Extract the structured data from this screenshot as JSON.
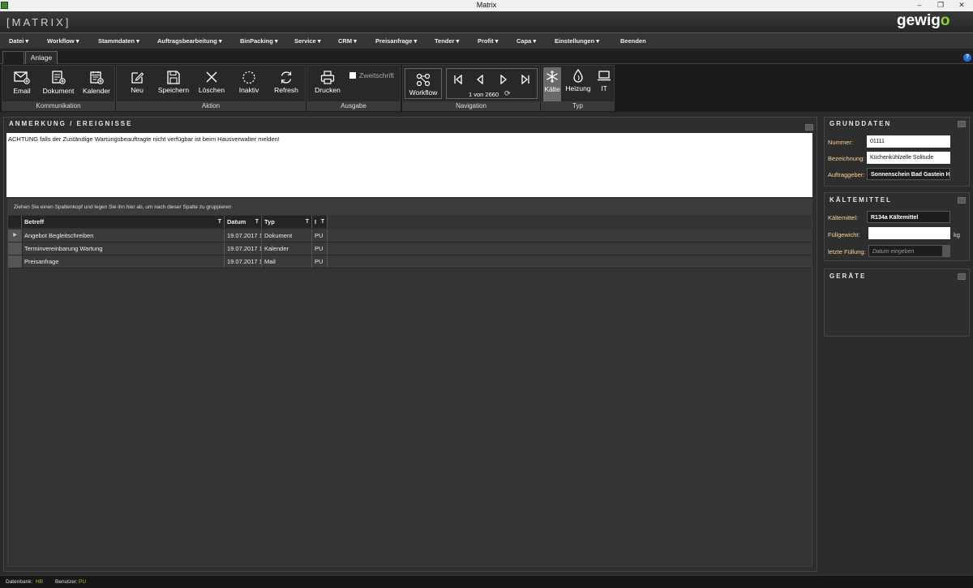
{
  "window": {
    "title": "Matrix",
    "min": "–",
    "max": "❐",
    "close": "✕"
  },
  "header": {
    "logo_left": "[MATRIX]",
    "logo_right_1": "gewig",
    "logo_right_2": "o"
  },
  "menu": [
    {
      "label": "Datei ▾"
    },
    {
      "label": "Workflow ▾"
    },
    {
      "label": "Stammdaten ▾"
    },
    {
      "label": "Auftragsbearbeitung ▾"
    },
    {
      "label": "BinPacking ▾"
    },
    {
      "label": "Service ▾"
    },
    {
      "label": "CRM ▾"
    },
    {
      "label": "Preisanfrage ▾"
    },
    {
      "label": "Tender ▾"
    },
    {
      "label": "Profit ▾"
    },
    {
      "label": "Capa ▾"
    },
    {
      "label": "Einstellungen ▾"
    },
    {
      "label": "Beenden"
    }
  ],
  "tabs": {
    "active": "Anlage",
    "help": "?"
  },
  "ribbon": {
    "kommunikation": {
      "label": "Kommunikation",
      "email": "Email",
      "dokument": "Dokument",
      "kalender": "Kalender"
    },
    "aktion": {
      "label": "Aktion",
      "neu": "Neu",
      "speichern": "Speichern",
      "loeschen": "Löschen",
      "inaktiv": "Inaktiv",
      "refresh": "Refresh"
    },
    "ausgabe": {
      "label": "Ausgabe",
      "drucken": "Drucken",
      "zweitschrift": "Zweitschrift"
    },
    "navigation": {
      "label": "Navigation",
      "workflow": "Workflow",
      "record": "1 von 2660"
    },
    "typ": {
      "label": "Typ",
      "kaelte": "Kälte",
      "heizung": "Heizung",
      "it": "IT"
    }
  },
  "notes": {
    "title": "ANMERKUNG / EREIGNISSE",
    "text": "ACHTUNG falls der Zuständige Wartungsbeauftragte nicht verfügbar ist beim Hausverwalter melden!"
  },
  "grid": {
    "group_hint": "Ziehen Sie einen Spaltenkopf und legen Sie ihn hier ab, um nach dieser Spalte zu gruppieren",
    "filter_icon": "T",
    "columns": [
      "Betreff",
      "Datum",
      "Typ",
      "I"
    ],
    "rows": [
      {
        "marker": "▶",
        "betreff": "Angebot Begleitschreiben",
        "datum": "19.07.2017 1",
        "typ": "Dokument",
        "i": "PU"
      },
      {
        "marker": "",
        "betreff": "Terminvereinbarung Wartung",
        "datum": "19.07.2017 1",
        "typ": "Kalender",
        "i": "PU"
      },
      {
        "marker": "",
        "betreff": "Preisanfrage",
        "datum": "19.07.2017 1",
        "typ": "Mail",
        "i": "PU"
      }
    ]
  },
  "grunddaten": {
    "title": "GRUNDDATEN",
    "nummer_label": "Nummer:",
    "nummer_value": "01111",
    "bezeichnung_label": "Bezeichnung:",
    "bezeichnung_value": "Küchenkühlzelle Solitude",
    "auftraggeber_label": "Auftraggeber:",
    "auftraggeber_value": "Sonnenschein Bad Gastein H"
  },
  "kaeltemittel": {
    "title": "KÄLTEMITTEL",
    "kaeltemittel_label": "Kältemittel:",
    "kaeltemittel_value": "R134a Kältemittel",
    "fuellgewicht_label": "Füllgewicht:",
    "fuellgewicht_value": "",
    "unit": "kg",
    "letzte_label": "letzte Füllung:",
    "letzte_placeholder": "Datum eingeben"
  },
  "geraete": {
    "title": "GERÄTE"
  },
  "status": {
    "db_label": "Datenbank:",
    "db_value": "HB",
    "user_label": "Benutzer:",
    "user_value": "PU"
  },
  "colors": {
    "accent_green": "#8cd12b",
    "label_orange": "#ffd29a"
  }
}
